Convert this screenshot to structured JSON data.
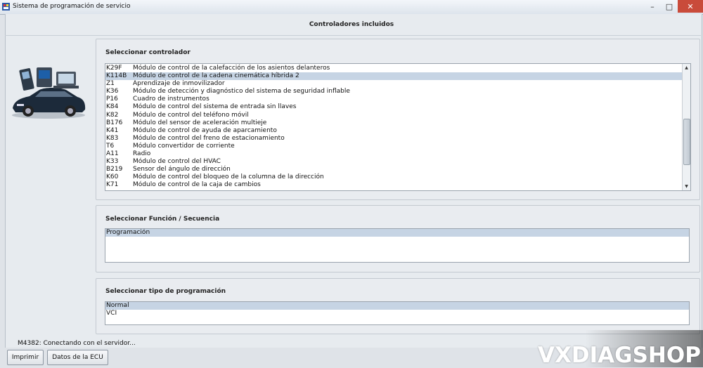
{
  "window": {
    "title": "Sistema de programación de servicio",
    "controls": [
      "–",
      "□",
      "✕"
    ]
  },
  "header": {
    "title": "Controladores incluidos"
  },
  "controller_panel": {
    "label": "Seleccionar controlador",
    "items": [
      {
        "code": "K29F",
        "desc": "Módulo de control de la calefacción de los asientos delanteros"
      },
      {
        "code": "K114B",
        "desc": "Módulo de control de la cadena cinemática híbrida 2",
        "selected": true
      },
      {
        "code": "Z1",
        "desc": "Aprendizaje de inmovilizador"
      },
      {
        "code": "K36",
        "desc": "Módulo de detección y diagnóstico del sistema de seguridad inflable"
      },
      {
        "code": "P16",
        "desc": "Cuadro de instrumentos"
      },
      {
        "code": "K84",
        "desc": "Módulo de control del sistema de entrada sin llaves"
      },
      {
        "code": "K82",
        "desc": "Módulo de control del teléfono móvil"
      },
      {
        "code": "B176",
        "desc": "Módulo del sensor de aceleración multieje"
      },
      {
        "code": "K41",
        "desc": "Módulo de control de ayuda de aparcamiento"
      },
      {
        "code": "K83",
        "desc": "Módulo de control del freno de estacionamiento"
      },
      {
        "code": "T6",
        "desc": "Módulo convertidor de corriente"
      },
      {
        "code": "A11",
        "desc": "Radio"
      },
      {
        "code": "K33",
        "desc": "Módulo de control del HVAC"
      },
      {
        "code": "B219",
        "desc": "Sensor del ángulo de dirección"
      },
      {
        "code": "K60",
        "desc": "Módulo de control del bloqueo de la columna de la dirección"
      },
      {
        "code": "K71",
        "desc": "Módulo de control de la caja de cambios"
      }
    ]
  },
  "function_panel": {
    "label": "Seleccionar Función / Secuencia",
    "items": [
      {
        "label": "Programación",
        "selected": true
      }
    ]
  },
  "programming_type_panel": {
    "label": "Seleccionar tipo de programación",
    "items": [
      {
        "label": "Normal",
        "selected": true
      },
      {
        "label": "VCI",
        "selected": false
      }
    ]
  },
  "status": {
    "text": "M4382: Conectando con el servidor..."
  },
  "buttons": {
    "print": "Imprimir",
    "ecu_data": "Datos de la ECU"
  },
  "watermark": "VXDIAGSHOP"
}
